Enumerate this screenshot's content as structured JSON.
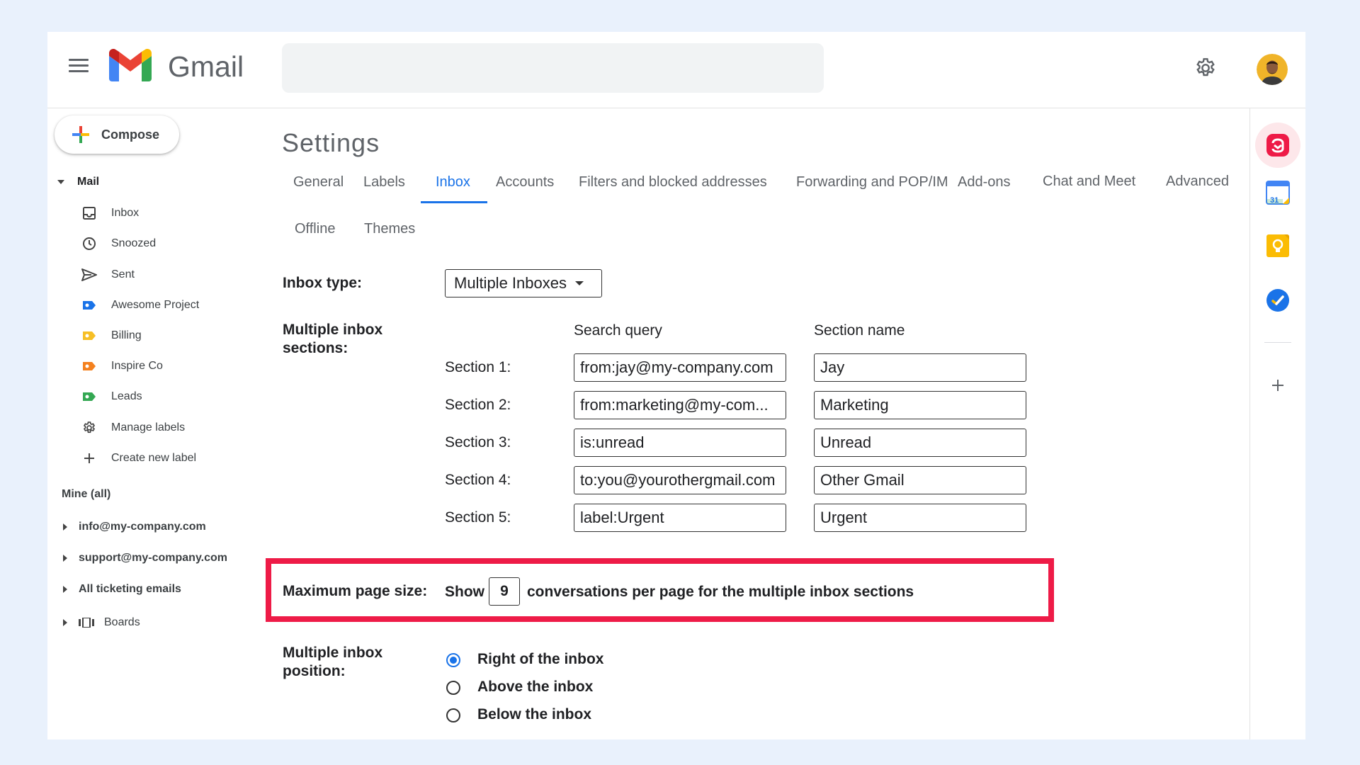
{
  "header": {
    "brand": "Gmail",
    "search_value": ""
  },
  "compose": {
    "label": "Compose"
  },
  "sidebar": {
    "mail_label": "Mail",
    "items": [
      {
        "label": "Inbox",
        "icon": "inbox-icon"
      },
      {
        "label": "Snoozed",
        "icon": "clock-icon"
      },
      {
        "label": "Sent",
        "icon": "send-icon"
      },
      {
        "label": "Awesome Project",
        "icon": "label-icon",
        "color": "#1a73e8"
      },
      {
        "label": "Billing",
        "icon": "label-icon",
        "color": "#f6bf26"
      },
      {
        "label": "Inspire Co",
        "icon": "label-icon",
        "color": "#f4811f"
      },
      {
        "label": "Leads",
        "icon": "label-icon",
        "color": "#34a853"
      },
      {
        "label": "Manage labels",
        "icon": "gear-icon"
      },
      {
        "label": "Create new label",
        "icon": "plus-icon"
      }
    ],
    "mine_label": "Mine (all)",
    "accounts": [
      {
        "label": "info@my-company.com"
      },
      {
        "label": "support@my-company.com"
      },
      {
        "label": "All ticketing emails"
      }
    ],
    "boards_label": "Boards"
  },
  "settings": {
    "title": "Settings",
    "tabs": [
      {
        "label": "General"
      },
      {
        "label": "Labels"
      },
      {
        "label": "Inbox",
        "active": true
      },
      {
        "label": "Accounts"
      },
      {
        "label": "Filters and blocked addresses"
      },
      {
        "label": "Forwarding and POP/IM"
      },
      {
        "label": "Add-ons"
      },
      {
        "label": "Chat and Meet"
      },
      {
        "label": "Advanced"
      },
      {
        "label": "Offline"
      },
      {
        "label": "Themes"
      }
    ],
    "inbox_type_label": "Inbox type:",
    "inbox_type_value": "Multiple Inboxes",
    "sections_label": "Multiple inbox sections:",
    "col_query": "Search query",
    "col_name": "Section name",
    "sections": [
      {
        "label": "Section 1:",
        "query": "from:jay@my-company.com",
        "name": "Jay"
      },
      {
        "label": "Section 2:",
        "query": "from:marketing@my-com...",
        "name": "Marketing"
      },
      {
        "label": "Section 3:",
        "query": "is:unread",
        "name": "Unread"
      },
      {
        "label": "Section 4:",
        "query": "to:you@yourothergmail.com",
        "name": "Other Gmail"
      },
      {
        "label": "Section 5:",
        "query": "label:Urgent",
        "name": "Urgent"
      }
    ],
    "page_size_label": "Maximum page size:",
    "page_size_show": "Show",
    "page_size_value": "9",
    "page_size_suffix": "conversations per page for the multiple inbox sections",
    "highlight_color": "#ee1b47",
    "position_label": "Multiple inbox position:",
    "positions": [
      {
        "label": "Right of the inbox",
        "checked": true
      },
      {
        "label": "Above the inbox",
        "checked": false
      },
      {
        "label": "Below the inbox",
        "checked": false
      }
    ]
  },
  "rail": {
    "apps": [
      "hiver-icon",
      "calendar-icon",
      "keep-icon",
      "tasks-icon"
    ],
    "calendar_day": "31"
  },
  "colors": {
    "accent": "#1a73e8",
    "text": "#202124",
    "muted": "#5f6368",
    "background": "#e9f1fc"
  }
}
